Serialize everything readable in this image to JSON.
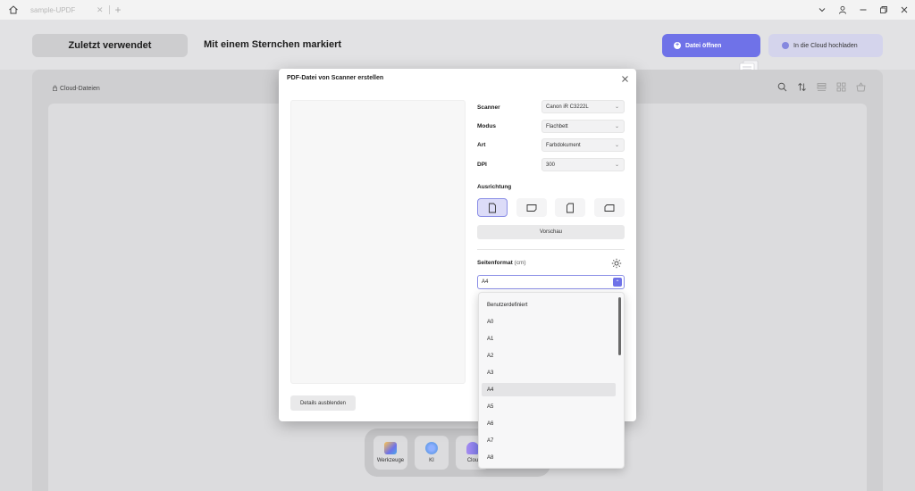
{
  "titlebar": {
    "tab_title": "sample-UPDF",
    "tab_close": "✕",
    "new_tab": "+",
    "icons": [
      "home-icon",
      "chevron-down-icon",
      "user-icon",
      "minimize-icon",
      "restore-icon",
      "close-icon"
    ]
  },
  "topbar": {
    "recent_label": "Zuletzt verwendet",
    "starred_label": "Mit einem Sternchen markiert",
    "open_label": "Datei öffnen",
    "cloud_upload_label": "In die Cloud hochladen",
    "accent_color": "#6f72e8"
  },
  "main": {
    "breadcrumb": "Cloud-Dateien",
    "toolbar_icons": [
      "search-icon",
      "sort-icon",
      "list-view-icon",
      "grid-view-icon",
      "basket-icon"
    ]
  },
  "dock": {
    "items": [
      {
        "label": "Werkzeuge",
        "icon": "tools-icon"
      },
      {
        "label": "KI",
        "icon": "ai-icon"
      },
      {
        "label": "Clou",
        "icon": "cloud-icon"
      }
    ]
  },
  "modal": {
    "title": "PDF-Datei von Scanner erstellen",
    "details_button": "Details ausblenden",
    "fields": [
      {
        "label": "Scanner",
        "value": "Canon iR C3222L"
      },
      {
        "label": "Modus",
        "value": "Flachbett"
      },
      {
        "label": "Art",
        "value": "Farbdokument"
      },
      {
        "label": "DPI",
        "value": "300"
      }
    ],
    "orientation_label": "Ausrichtung",
    "orientation_options": [
      "portrait-icon",
      "landscape-icon",
      "portrait-rotated-icon",
      "landscape-rotated-icon"
    ],
    "orientation_selected": 0,
    "preview_button": "Vorschau",
    "page_format_label": "Seitenformat",
    "page_format_unit": "(cm)",
    "page_format_value": "A4"
  },
  "dropdown": {
    "options": [
      "Benutzerdefiniert",
      "A0",
      "A1",
      "A2",
      "A3",
      "A4",
      "A5",
      "A6",
      "A7",
      "A8"
    ],
    "selected": "A4"
  }
}
